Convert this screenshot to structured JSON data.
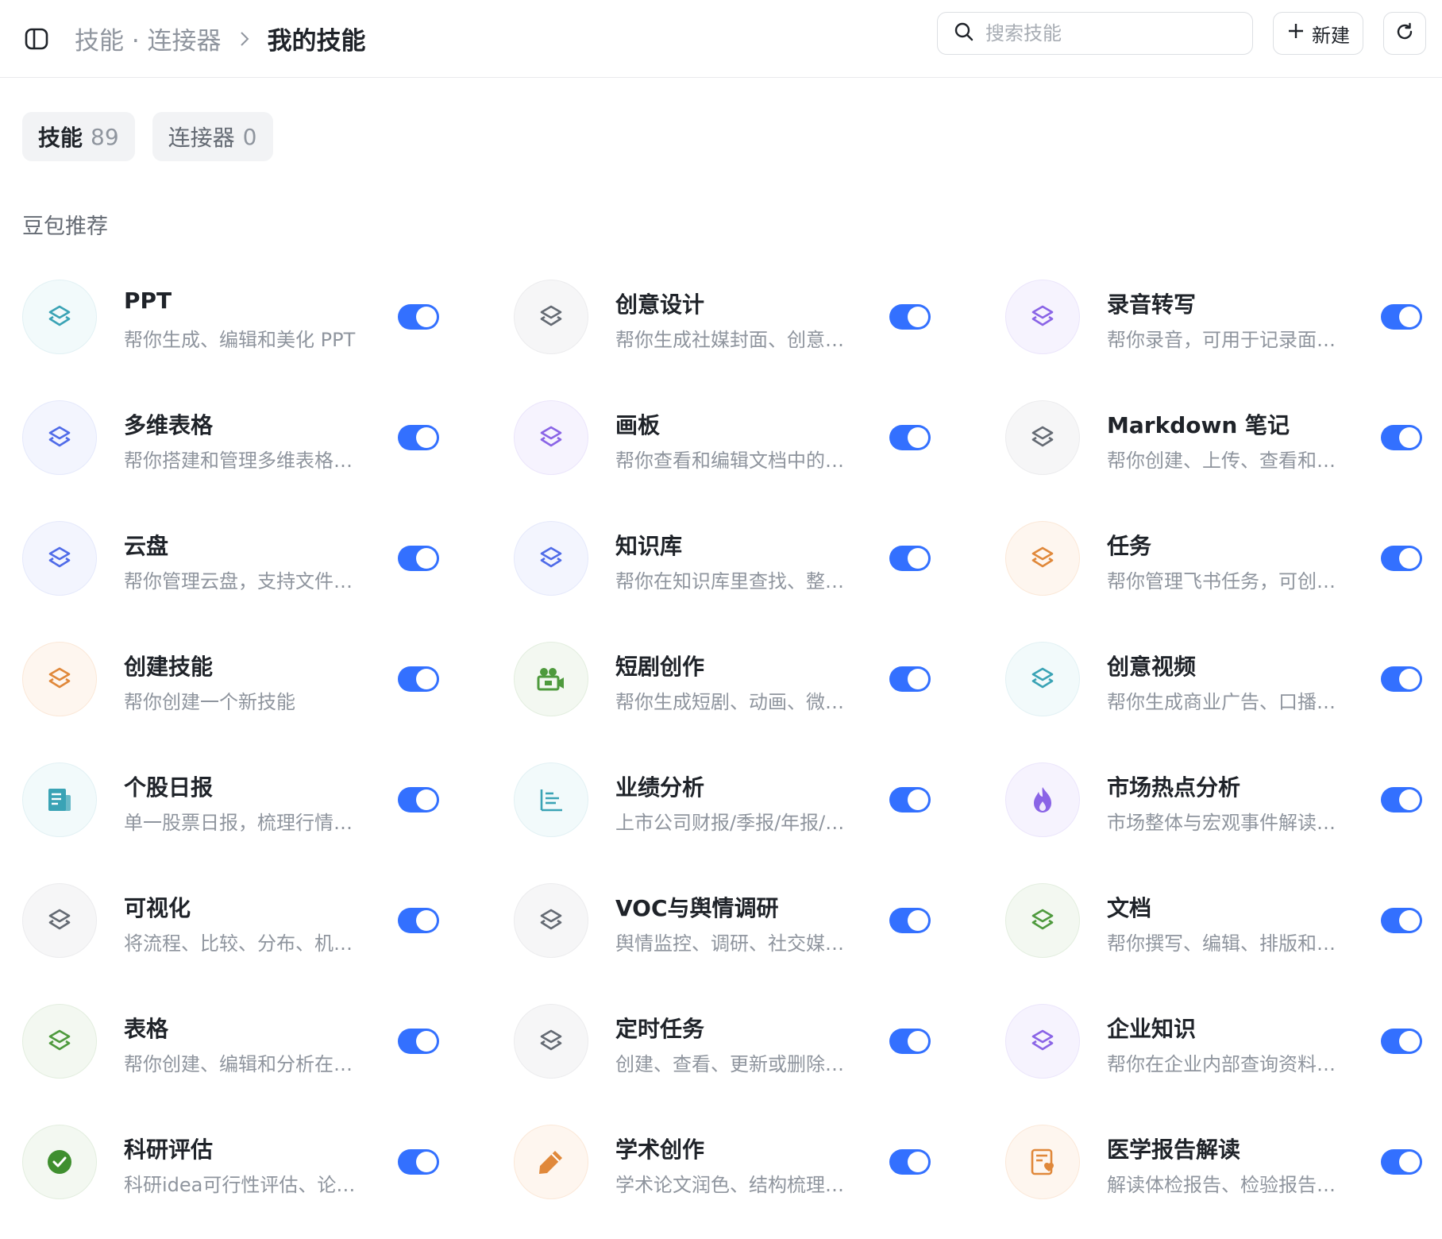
{
  "header": {
    "breadcrumb_parent": "技能 · 连接器",
    "breadcrumb_current": "我的技能",
    "search_placeholder": "搜索技能",
    "new_label": "新建"
  },
  "tabs": [
    {
      "label": "技能",
      "count": "89",
      "active": true
    },
    {
      "label": "连接器",
      "count": "0",
      "active": false
    }
  ],
  "section_title": "豆包推荐",
  "colors": {
    "accent": "#3370ff",
    "teal": "#3aa3b5",
    "gray": "#646a73",
    "purple": "#8a64e6",
    "blue": "#4f6be8",
    "orange": "#e0883a",
    "green": "#4e9a3d",
    "green_check": "#3f8f2f"
  },
  "skills": [
    {
      "title": "PPT",
      "desc": "帮你生成、编辑和美化 PPT",
      "icon": "layers-icon",
      "color": "teal",
      "enabled": true
    },
    {
      "title": "创意设计",
      "desc": "帮你生成社媒封面、创意海报等",
      "icon": "layers-icon",
      "color": "gray",
      "enabled": true
    },
    {
      "title": "录音转写",
      "desc": "帮你录音，可用于记录面聊内容",
      "icon": "layers-icon",
      "color": "purple",
      "enabled": true
    },
    {
      "title": "多维表格",
      "desc": "帮你搭建和管理多维表格，支持",
      "icon": "layers-icon",
      "color": "blue",
      "enabled": true
    },
    {
      "title": "画板",
      "desc": "帮你查看和编辑文档中的画板内容",
      "icon": "layers-icon",
      "color": "purple",
      "enabled": true
    },
    {
      "title": "Markdown 笔记",
      "desc": "帮你创建、上传、查看和编辑笔记",
      "icon": "layers-icon",
      "color": "gray",
      "enabled": true
    },
    {
      "title": "云盘",
      "desc": "帮你管理云盘，支持文件的上传",
      "icon": "layers-icon",
      "color": "blue",
      "enabled": true
    },
    {
      "title": "知识库",
      "desc": "帮你在知识库里查找、整理内容",
      "icon": "layers-icon",
      "color": "blue",
      "enabled": true
    },
    {
      "title": "任务",
      "desc": "帮你管理飞书任务，可创建任务",
      "icon": "layers-icon",
      "color": "orange",
      "enabled": true
    },
    {
      "title": "创建技能",
      "desc": "帮你创建一个新技能",
      "icon": "layers-icon",
      "color": "orange",
      "enabled": true
    },
    {
      "title": "短剧创作",
      "desc": "帮你生成短剧、动画、微电影",
      "icon": "video-camera-icon",
      "color": "green",
      "enabled": true
    },
    {
      "title": "创意视频",
      "desc": "帮你生成商业广告、口播视频等",
      "icon": "layers-icon",
      "color": "teal",
      "enabled": true
    },
    {
      "title": "个股日报",
      "desc": "单一股票日报，梳理行情、资讯",
      "icon": "report-icon",
      "color": "teal",
      "enabled": true
    },
    {
      "title": "业绩分析",
      "desc": "上市公司财报/季报/年报/业绩分析",
      "icon": "bar-list-icon",
      "color": "teal",
      "enabled": true
    },
    {
      "title": "市场热点分析",
      "desc": "市场整体与宏观事件解读，分析",
      "icon": "flame-icon",
      "color": "purple",
      "enabled": true
    },
    {
      "title": "可视化",
      "desc": "将流程、比较、分布、机制等可视化",
      "icon": "layers-icon",
      "color": "gray",
      "enabled": true
    },
    {
      "title": "VOC与舆情调研",
      "desc": "舆情监控、调研、社交媒体分析",
      "icon": "layers-icon",
      "color": "gray",
      "enabled": true
    },
    {
      "title": "文档",
      "desc": "帮你撰写、编辑、排版和优化文档",
      "icon": "layers-icon",
      "color": "green",
      "enabled": true
    },
    {
      "title": "表格",
      "desc": "帮你创建、编辑和分析在线表格",
      "icon": "layers-icon",
      "color": "green",
      "enabled": true
    },
    {
      "title": "定时任务",
      "desc": "创建、查看、更新或删除定时任务",
      "icon": "layers-icon",
      "color": "gray",
      "enabled": true
    },
    {
      "title": "企业知识",
      "desc": "帮你在企业内部查询资料和知识",
      "icon": "layers-icon",
      "color": "purple",
      "enabled": true
    },
    {
      "title": "科研评估",
      "desc": "科研idea可行性评估、论文评审",
      "icon": "check-circle-icon",
      "color": "green_check",
      "enabled": true
    },
    {
      "title": "学术创作",
      "desc": "学术论文润色、结构梳理、写作",
      "icon": "pencil-icon",
      "color": "orange",
      "enabled": true
    },
    {
      "title": "医学报告解读",
      "desc": "解读体检报告、检验报告、影像报告",
      "icon": "medical-report-icon",
      "color": "orange",
      "enabled": true
    }
  ]
}
